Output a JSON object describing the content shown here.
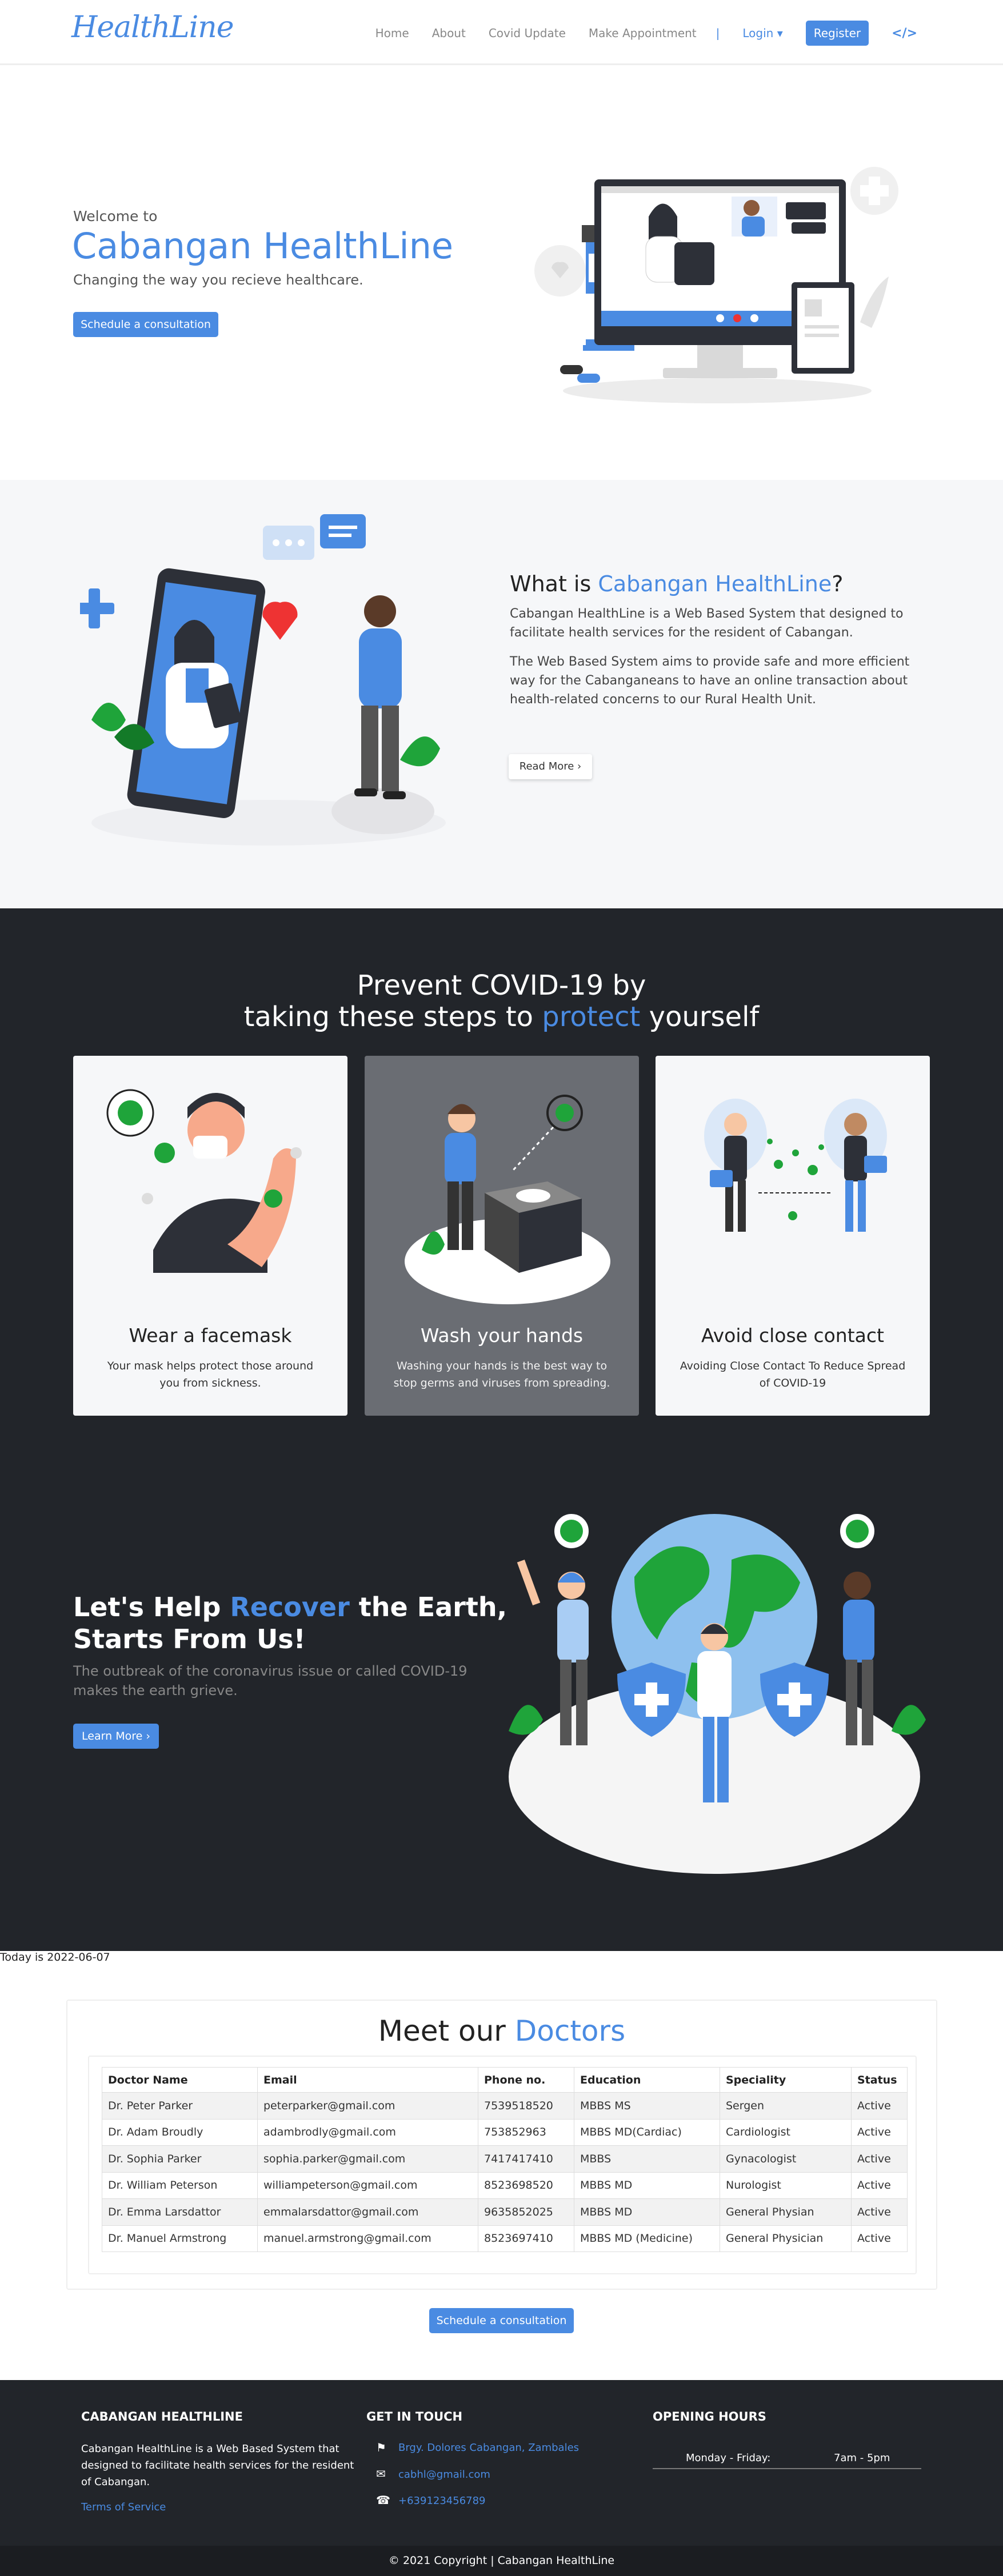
{
  "brand": "HealthLine",
  "nav": {
    "items": [
      "Home",
      "About",
      "Covid Update",
      "Make Appointment"
    ],
    "separator": "|",
    "login": "Login ▾",
    "register": "Register",
    "code_icon": "</>"
  },
  "hero": {
    "welcome": "Welcome to",
    "title": "Cabangan HealthLine",
    "subtitle": "Changing the way you recieve healthcare.",
    "button": "Schedule a consultation"
  },
  "about": {
    "title_prefix": "What is ",
    "title_highlight": "Cabangan HealthLine",
    "title_suffix": "?",
    "p1": "Cabangan HealthLine is a Web Based System that designed to facilitate health services for the resident of Cabangan.",
    "p2": "The Web Based System aims to provide safe and more efficient way for the Cabanganeans to have an online transaction about health-related concerns to our Rural Health Unit.",
    "button": "Read More ›"
  },
  "covid": {
    "line1": "Prevent COVID-19 by",
    "line2_prefix": "taking these steps to ",
    "line2_highlight": "protect",
    "line2_suffix": " yourself",
    "cards": [
      {
        "title": "Wear a facemask",
        "text": "Your mask helps protect those around you from sickness."
      },
      {
        "title": "Wash your hands",
        "text": "Washing your hands is the best way to stop germs and viruses from spreading."
      },
      {
        "title": "Avoid close contact",
        "text": "Avoiding Close Contact To Reduce Spread of COVID-19"
      }
    ],
    "earth_prefix": "Let's Help ",
    "earth_highlight": "Recover",
    "earth_suffix": " the Earth, Starts From Us!",
    "earth_sub": "The outbreak of the coronavirus issue or called COVID-19 makes the earth grieve.",
    "learn_button": "Learn More ›"
  },
  "today": "Today is 2022-06-07",
  "doctors": {
    "title_prefix": "Meet our ",
    "title_highlight": "Doctors",
    "columns": [
      "Doctor Name",
      "Email",
      "Phone no.",
      "Education",
      "Speciality",
      "Status"
    ],
    "rows": [
      [
        "Dr. Peter Parker",
        "peterparker@gmail.com",
        "7539518520",
        "MBBS MS",
        "Sergen",
        "Active"
      ],
      [
        "Dr. Adam Broudly",
        "adambrodly@gmail.com",
        "753852963",
        "MBBS MD(Cardiac)",
        "Cardiologist",
        "Active"
      ],
      [
        "Dr. Sophia Parker",
        "sophia.parker@gmail.com",
        "7417417410",
        "MBBS",
        "Gynacologist",
        "Active"
      ],
      [
        "Dr. William Peterson",
        "williampeterson@gmail.com",
        "8523698520",
        "MBBS MD",
        "Nurologist",
        "Active"
      ],
      [
        "Dr. Emma Larsdattor",
        "emmalarsdattor@gmail.com",
        "9635852025",
        "MBBS MD",
        "General Physian",
        "Active"
      ],
      [
        "Dr. Manuel Armstrong",
        "manuel.armstrong@gmail.com",
        "8523697410",
        "MBBS MD (Medicine)",
        "General Physician",
        "Active"
      ]
    ],
    "button": "Schedule a consultation"
  },
  "footer": {
    "col1_title": "CABANGAN HEALTHLINE",
    "col1_text": "Cabangan HealthLine is a Web Based System that designed to facilitate health services for the resident of Cabangan.",
    "terms": "Terms of Service",
    "col2_title": "GET IN TOUCH",
    "address": "Brgy. Dolores Cabangan, Zambales",
    "email": "cabhl@gmail.com",
    "phone": "+639123456789",
    "col3_title": "OPENING HOURS",
    "days": "Monday - Friday:",
    "time": "7am - 5pm",
    "copyright": "© 2021 Copyright | Cabangan HealthLine"
  }
}
